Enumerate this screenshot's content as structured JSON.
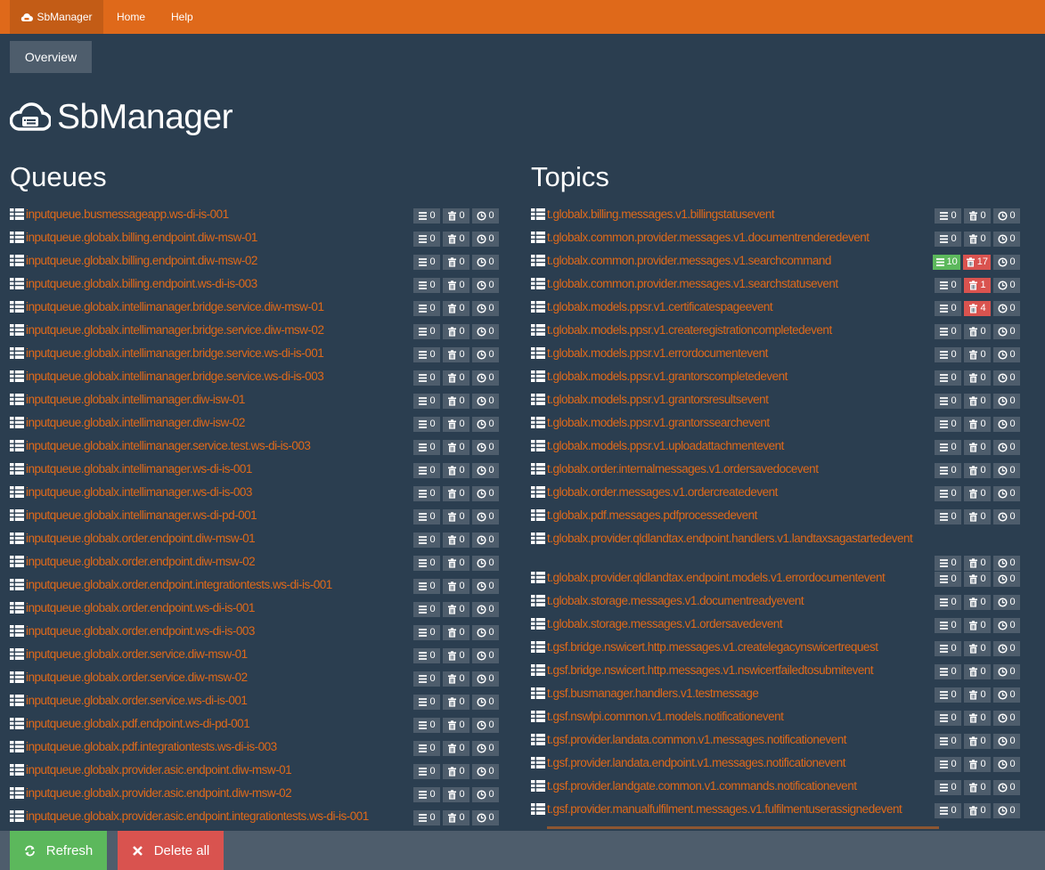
{
  "nav": {
    "brand": "SbManager",
    "items": [
      "Home",
      "Help"
    ]
  },
  "overview_label": "Overview",
  "app_title": "SbManager",
  "queues": {
    "heading": "Queues",
    "items": [
      {
        "name": "inputqueue.busmessageapp.ws-di-is-001",
        "active": "0",
        "dead": "0",
        "scheduled": "0"
      },
      {
        "name": "inputqueue.globalx.billing.endpoint.diw-msw-01",
        "active": "0",
        "dead": "0",
        "scheduled": "0"
      },
      {
        "name": "inputqueue.globalx.billing.endpoint.diw-msw-02",
        "active": "0",
        "dead": "0",
        "scheduled": "0"
      },
      {
        "name": "inputqueue.globalx.billing.endpoint.ws-di-is-003",
        "active": "0",
        "dead": "0",
        "scheduled": "0"
      },
      {
        "name": "inputqueue.globalx.intellimanager.bridge.service.diw-msw-01",
        "active": "0",
        "dead": "0",
        "scheduled": "0"
      },
      {
        "name": "inputqueue.globalx.intellimanager.bridge.service.diw-msw-02",
        "active": "0",
        "dead": "0",
        "scheduled": "0"
      },
      {
        "name": "inputqueue.globalx.intellimanager.bridge.service.ws-di-is-001",
        "active": "0",
        "dead": "0",
        "scheduled": "0"
      },
      {
        "name": "inputqueue.globalx.intellimanager.bridge.service.ws-di-is-003",
        "active": "0",
        "dead": "0",
        "scheduled": "0"
      },
      {
        "name": "inputqueue.globalx.intellimanager.diw-isw-01",
        "active": "0",
        "dead": "0",
        "scheduled": "0"
      },
      {
        "name": "inputqueue.globalx.intellimanager.diw-isw-02",
        "active": "0",
        "dead": "0",
        "scheduled": "0"
      },
      {
        "name": "inputqueue.globalx.intellimanager.service.test.ws-di-is-003",
        "active": "0",
        "dead": "0",
        "scheduled": "0"
      },
      {
        "name": "inputqueue.globalx.intellimanager.ws-di-is-001",
        "active": "0",
        "dead": "0",
        "scheduled": "0"
      },
      {
        "name": "inputqueue.globalx.intellimanager.ws-di-is-003",
        "active": "0",
        "dead": "0",
        "scheduled": "0"
      },
      {
        "name": "inputqueue.globalx.intellimanager.ws-di-pd-001",
        "active": "0",
        "dead": "0",
        "scheduled": "0"
      },
      {
        "name": "inputqueue.globalx.order.endpoint.diw-msw-01",
        "active": "0",
        "dead": "0",
        "scheduled": "0"
      },
      {
        "name": "inputqueue.globalx.order.endpoint.diw-msw-02",
        "active": "0",
        "dead": "0",
        "scheduled": "0"
      },
      {
        "name": "inputqueue.globalx.order.endpoint.integrationtests.ws-di-is-001",
        "active": "0",
        "dead": "0",
        "scheduled": "0"
      },
      {
        "name": "inputqueue.globalx.order.endpoint.ws-di-is-001",
        "active": "0",
        "dead": "0",
        "scheduled": "0"
      },
      {
        "name": "inputqueue.globalx.order.endpoint.ws-di-is-003",
        "active": "0",
        "dead": "0",
        "scheduled": "0"
      },
      {
        "name": "inputqueue.globalx.order.service.diw-msw-01",
        "active": "0",
        "dead": "0",
        "scheduled": "0"
      },
      {
        "name": "inputqueue.globalx.order.service.diw-msw-02",
        "active": "0",
        "dead": "0",
        "scheduled": "0"
      },
      {
        "name": "inputqueue.globalx.order.service.ws-di-is-001",
        "active": "0",
        "dead": "0",
        "scheduled": "0"
      },
      {
        "name": "inputqueue.globalx.pdf.endpoint.ws-di-pd-001",
        "active": "0",
        "dead": "0",
        "scheduled": "0"
      },
      {
        "name": "inputqueue.globalx.pdf.integrationtests.ws-di-is-003",
        "active": "0",
        "dead": "0",
        "scheduled": "0"
      },
      {
        "name": "inputqueue.globalx.provider.asic.endpoint.diw-msw-01",
        "active": "0",
        "dead": "0",
        "scheduled": "0"
      },
      {
        "name": "inputqueue.globalx.provider.asic.endpoint.diw-msw-02",
        "active": "0",
        "dead": "0",
        "scheduled": "0"
      },
      {
        "name": "inputqueue.globalx.provider.asic.endpoint.integrationtests.ws-di-is-001",
        "active": "0",
        "dead": "0",
        "scheduled": "0"
      }
    ]
  },
  "topics": {
    "heading": "Topics",
    "items": [
      {
        "name": "t.globalx.billing.messages.v1.billingstatusevent",
        "active": "0",
        "dead": "0",
        "scheduled": "0"
      },
      {
        "name": "t.globalx.common.provider.messages.v1.documentrenderedevent",
        "active": "0",
        "dead": "0",
        "scheduled": "0"
      },
      {
        "name": "t.globalx.common.provider.messages.v1.searchcommand",
        "active": "10",
        "dead": "17",
        "scheduled": "0",
        "active_color": "green",
        "dead_color": "red"
      },
      {
        "name": "t.globalx.common.provider.messages.v1.searchstatusevent",
        "active": "0",
        "dead": "1",
        "scheduled": "0",
        "dead_color": "red"
      },
      {
        "name": "t.globalx.models.ppsr.v1.certificatespageevent",
        "active": "0",
        "dead": "4",
        "scheduled": "0",
        "dead_color": "red"
      },
      {
        "name": "t.globalx.models.ppsr.v1.createregistrationcompletedevent",
        "active": "0",
        "dead": "0",
        "scheduled": "0"
      },
      {
        "name": "t.globalx.models.ppsr.v1.errordocumentevent",
        "active": "0",
        "dead": "0",
        "scheduled": "0"
      },
      {
        "name": "t.globalx.models.ppsr.v1.grantorscompletedevent",
        "active": "0",
        "dead": "0",
        "scheduled": "0"
      },
      {
        "name": "t.globalx.models.ppsr.v1.grantorsresultsevent",
        "active": "0",
        "dead": "0",
        "scheduled": "0"
      },
      {
        "name": "t.globalx.models.ppsr.v1.grantorssearchevent",
        "active": "0",
        "dead": "0",
        "scheduled": "0"
      },
      {
        "name": "t.globalx.models.ppsr.v1.uploadattachmentevent",
        "active": "0",
        "dead": "0",
        "scheduled": "0"
      },
      {
        "name": "t.globalx.order.internalmessages.v1.ordersavedocevent",
        "active": "0",
        "dead": "0",
        "scheduled": "0"
      },
      {
        "name": "t.globalx.order.messages.v1.ordercreatedevent",
        "active": "0",
        "dead": "0",
        "scheduled": "0"
      },
      {
        "name": "t.globalx.pdf.messages.pdfprocessedevent",
        "active": "0",
        "dead": "0",
        "scheduled": "0"
      },
      {
        "name": "t.globalx.provider.qldlandtax.endpoint.handlers.v1.landtaxsagastartedevent",
        "active": "0",
        "dead": "0",
        "scheduled": "0",
        "wrapped": true
      },
      {
        "name": "t.globalx.provider.qldlandtax.endpoint.models.v1.errordocumentevent",
        "active": "0",
        "dead": "0",
        "scheduled": "0"
      },
      {
        "name": "t.globalx.storage.messages.v1.documentreadyevent",
        "active": "0",
        "dead": "0",
        "scheduled": "0"
      },
      {
        "name": "t.globalx.storage.messages.v1.ordersavedevent",
        "active": "0",
        "dead": "0",
        "scheduled": "0"
      },
      {
        "name": "t.gsf.bridge.nswicert.http.messages.v1.createlegacynswicertrequest",
        "active": "0",
        "dead": "0",
        "scheduled": "0"
      },
      {
        "name": "t.gsf.bridge.nswicert.http.messages.v1.nswicertfailedtosubmitevent",
        "active": "0",
        "dead": "0",
        "scheduled": "0"
      },
      {
        "name": "t.gsf.busmanager.handlers.v1.testmessage",
        "active": "0",
        "dead": "0",
        "scheduled": "0"
      },
      {
        "name": "t.gsf.nswlpi.common.v1.models.notificationevent",
        "active": "0",
        "dead": "0",
        "scheduled": "0"
      },
      {
        "name": "t.gsf.provider.landata.common.v1.messages.notificationevent",
        "active": "0",
        "dead": "0",
        "scheduled": "0"
      },
      {
        "name": "t.gsf.provider.landata.endpoint.v1.messages.notificationevent",
        "active": "0",
        "dead": "0",
        "scheduled": "0"
      },
      {
        "name": "t.gsf.provider.landgate.common.v1.commands.notificationevent",
        "active": "0",
        "dead": "0",
        "scheduled": "0"
      },
      {
        "name": "t.gsf.provider.manualfulfilment.messages.v1.fulfilmentuserassignedevent",
        "active": "0",
        "dead": "0",
        "scheduled": "0"
      }
    ]
  },
  "actions": {
    "refresh_label": "Refresh",
    "delete_all_label": "Delete all"
  },
  "colors": {
    "navbar": "#df691a",
    "background": "#2b3e50",
    "link": "#df691a",
    "badge": "#4e5d6c",
    "success": "#5cb85c",
    "danger": "#d9534f"
  }
}
